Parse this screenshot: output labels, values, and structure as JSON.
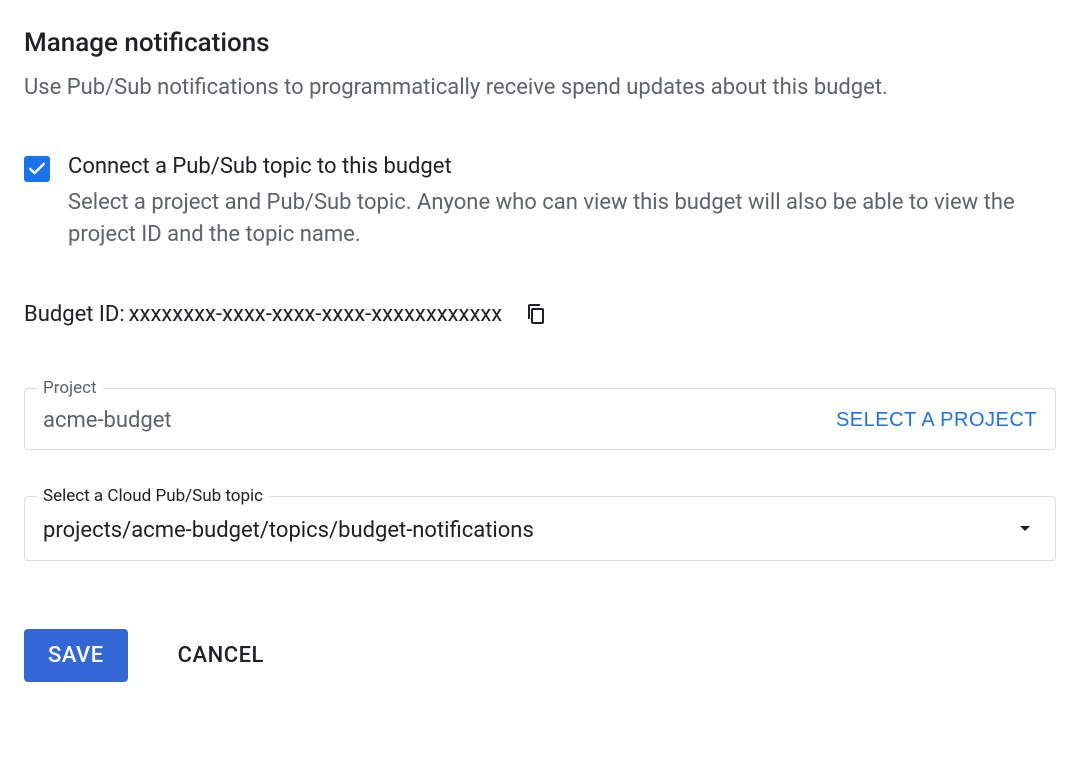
{
  "section": {
    "title": "Manage notifications",
    "description": "Use Pub/Sub notifications to programmatically receive spend updates about this budget."
  },
  "checkbox": {
    "label": "Connect a Pub/Sub topic to this budget",
    "description": "Select a project and Pub/Sub topic. Anyone who can view this budget will also be able to view the project ID and the topic name."
  },
  "budgetId": {
    "label": "Budget ID:",
    "value": "xxxxxxxx-xxxx-xxxx-xxxx-xxxxxxxxxxxx"
  },
  "projectField": {
    "label": "Project",
    "value": "acme-budget",
    "selectButton": "SELECT A PROJECT"
  },
  "topicField": {
    "label": "Select a Cloud Pub/Sub topic",
    "value": "projects/acme-budget/topics/budget-notifications"
  },
  "buttons": {
    "save": "SAVE",
    "cancel": "CANCEL"
  }
}
